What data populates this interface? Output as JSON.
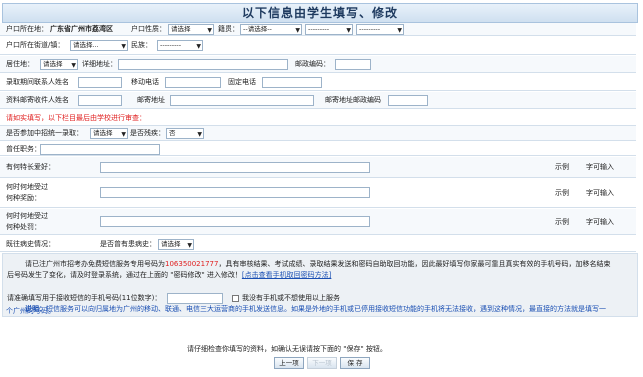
{
  "title": "以下信息由学生填写、修改",
  "row1": {
    "hukou_label": "户口所在地：",
    "hukou_value": "广东省广州市荔湾区",
    "hukou_type_label": "户口性质：",
    "hukou_type_value": "请选择",
    "native_label": "籍贯：",
    "native_province": "--请选择--",
    "native_city": "---------",
    "native_district": "---------"
  },
  "row2": {
    "police_label": "户口所在街道/镇：",
    "police_value": "请选择...",
    "ethnic_label": "民族：",
    "ethnic_value": "---------"
  },
  "row3": {
    "residence_label": "居住地：",
    "residence_value": "请选择",
    "address_label": "详细地址：",
    "postcode_label": "邮政编码："
  },
  "row4": {
    "contact_label": "录取期间联系人姓名",
    "mobile_label": "移动电话",
    "phone_label": "固定电话"
  },
  "row5": {
    "receiver_label": "资料邮寄收件人姓名",
    "mail_address_label": "邮寄地址",
    "mail_postcode_label": "邮寄地址邮政编码"
  },
  "warning": "请如实填写，以下栏目最后由学校进行审查：",
  "row6": {
    "early_label": "是否参加中招统一录取：",
    "early_value": "请选择",
    "resident_label": "是否残疾：",
    "resident_value": "否"
  },
  "row7": {
    "duty_label": "曾任职务："
  },
  "row8": {
    "specialty_label": "有何特长爱好：",
    "example": "示例",
    "input_hint": "字可输入"
  },
  "row9": {
    "award_label_1": "何时何地受过",
    "award_label_2": "何种奖励：",
    "example": "示例",
    "input_hint": "字可输入"
  },
  "row10": {
    "punish_label_1": "何时何地受过",
    "punish_label_2": "何种处罚：",
    "example": "示例",
    "input_hint": "字可输入"
  },
  "row11": {
    "medical_label": "既往病史情况：",
    "disease_label": "是否曾有患病史：",
    "disease_value": "请选择"
  },
  "notice": {
    "line1_a": "请已注广州市招考办免费短信服务专用号码为",
    "sms_number": "106350021777",
    "line1_b": "，具有审核结果、考试成绩、录取结果发送和密码自助取回功能，因此最好填写你家最可靠且真实有效的手机号码，加移名结束",
    "line2_a": "后号码发生了变化，请及时登录系统，通过在上面的 \"密码修改\" 进入修改！",
    "line2_link": "[点击查看手机取回密码方法]",
    "sms_label": "请准确填写用于接收短信的手机号码(11位数字)：",
    "no_phone": "我没有手机或不想使用以上服务",
    "explain_title": "说明：",
    "explain_a": "短信服务可以向归属地为广州的移动、联通、电信三大运营商的手机发送信息。如果是外地的手机或已停用接收短信功能的手机将无法接收，遇到这种情况，最直接的方法就是填写一",
    "explain_b": "个广州的号码。"
  },
  "footer": {
    "hint": "请仔细检查你填写的资料，如确认无误请按下面的 \"保存\" 按钮。",
    "prev": "上一项",
    "next": "下一项",
    "save": "保 存"
  }
}
